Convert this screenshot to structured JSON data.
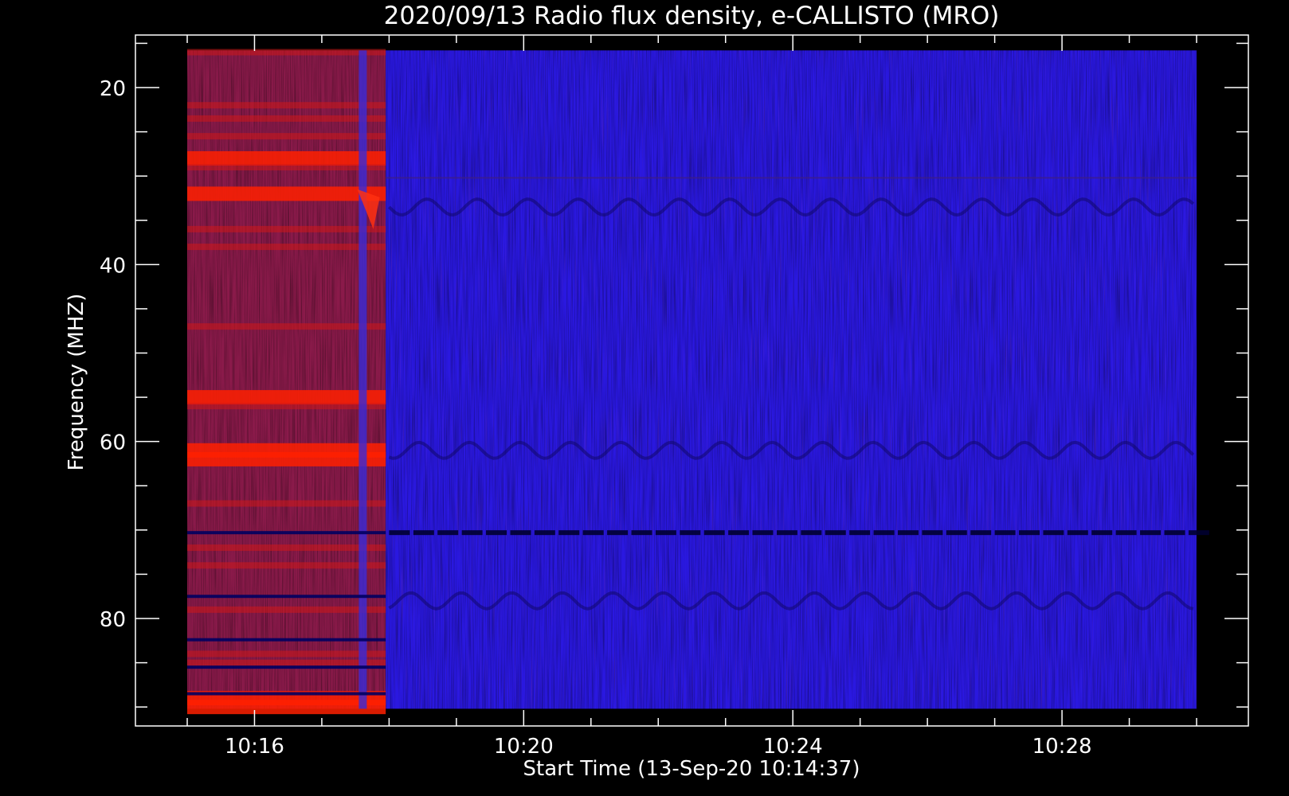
{
  "chart_data": {
    "type": "heatmap",
    "title": "2020/09/13  Radio flux density, e-CALLISTO (MRO)",
    "xlabel": "Start Time (13-Sep-20 10:14:37)",
    "ylabel": "Frequency (MHZ)",
    "y_axis_inverted": true,
    "ylim": [
      15,
      92
    ],
    "x_range_minutes": [
      "10:15:00",
      "10:30:00"
    ],
    "x_ticks": [
      {
        "label": "10:16",
        "minute": 16
      },
      {
        "label": "10:20",
        "minute": 20
      },
      {
        "label": "10:24",
        "minute": 24
      },
      {
        "label": "10:28",
        "minute": 28
      }
    ],
    "x_minor_ticks_minutes": [
      15,
      17,
      18,
      19,
      21,
      22,
      23,
      25,
      26,
      27,
      29,
      30
    ],
    "y_ticks": [
      {
        "label": "20",
        "value": 20
      },
      {
        "label": "40",
        "value": 40
      },
      {
        "label": "60",
        "value": 60
      },
      {
        "label": "80",
        "value": 80
      }
    ],
    "y_minor_ticks": [
      15,
      25,
      30,
      35,
      45,
      50,
      55,
      65,
      70,
      75,
      85,
      90
    ],
    "data_extent": {
      "t_start_min": 15.0,
      "t_end_min": 30.0,
      "f_min_mhz": 15.8,
      "f_max_mhz": 90.2
    },
    "regions": [
      {
        "name": "elevated-flux",
        "t_start_min": 15.0,
        "t_end_min": 17.95,
        "color": "#8a1a4a"
      },
      {
        "name": "background",
        "t_start_min": 17.95,
        "t_end_min": 30.0,
        "color": "#2a18e0"
      }
    ],
    "red_bands_mhz": [
      16,
      22,
      23.5,
      25.5,
      28,
      29,
      32,
      36,
      38,
      47,
      55,
      56,
      61,
      62,
      67,
      72,
      74,
      79,
      84,
      85,
      89,
      90
    ],
    "dark_lines_mhz": [
      70.3,
      77.5,
      82.4,
      85.5,
      88.5
    ],
    "burst": {
      "t_min": 17.6,
      "f_start_mhz": 31.5,
      "f_end_mhz": 36
    },
    "colors": {
      "background": "#000000",
      "axis": "#ffffff",
      "low": "#1a10e0",
      "high": "#ff1a00"
    }
  }
}
